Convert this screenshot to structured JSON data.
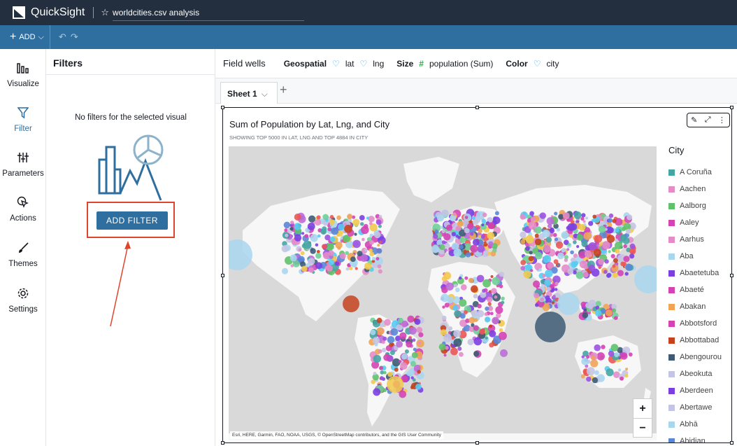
{
  "app": {
    "brand": "QuickSight",
    "analysis_title": "worldcities.csv analysis"
  },
  "toolbar": {
    "add_label": "ADD",
    "undo": "↶",
    "redo": "↷"
  },
  "nav": [
    {
      "label": "Visualize",
      "icon": "bar-chart-icon"
    },
    {
      "label": "Filter",
      "icon": "filter-icon"
    },
    {
      "label": "Parameters",
      "icon": "sliders-icon"
    },
    {
      "label": "Actions",
      "icon": "cursor-click-icon"
    },
    {
      "label": "Themes",
      "icon": "brush-icon"
    },
    {
      "label": "Settings",
      "icon": "gear-icon"
    }
  ],
  "filters": {
    "heading": "Filters",
    "empty_message": "No filters for the selected visual",
    "add_filter_label": "ADD FILTER"
  },
  "fieldwells": {
    "title": "Field wells",
    "geo_label": "Geospatial",
    "geo_1": "lat",
    "geo_2": "lng",
    "size_label": "Size",
    "size_value": "population (Sum)",
    "color_label": "Color",
    "color_value": "city"
  },
  "sheet": {
    "tab_label": "Sheet 1"
  },
  "visual": {
    "title": "Sum of Population by Lat, Lng, and City",
    "subtitle": "SHOWING TOP 5000 IN LAT, LNG AND TOP 4884 IN CITY",
    "attribution": "Esri, HERE, Garmin, FAO, NOAA, USGS, © OpenStreetMap contributors, and the GIS User Community",
    "zoom_in": "+",
    "zoom_out": "−",
    "legend_title": "City",
    "legend": [
      {
        "label": "A Coruña",
        "color": "#45a5a3"
      },
      {
        "label": "Aachen",
        "color": "#e38cc8"
      },
      {
        "label": "Aalborg",
        "color": "#5fc26a"
      },
      {
        "label": "Aaley",
        "color": "#d442b4"
      },
      {
        "label": "Aarhus",
        "color": "#e38cc8"
      },
      {
        "label": "Aba",
        "color": "#a9d6ef"
      },
      {
        "label": "Abaetetuba",
        "color": "#7b3fe0"
      },
      {
        "label": "Abaeté",
        "color": "#d442b4"
      },
      {
        "label": "Abakan",
        "color": "#f0a454"
      },
      {
        "label": "Abbotsford",
        "color": "#d442b4"
      },
      {
        "label": "Abbottabad",
        "color": "#c5421e"
      },
      {
        "label": "Abengourou",
        "color": "#3e5b73"
      },
      {
        "label": "Abeokuta",
        "color": "#c4c4e4"
      },
      {
        "label": "Aberdeen",
        "color": "#7b3fe0"
      },
      {
        "label": "Abertawe",
        "color": "#c4c4e4"
      },
      {
        "label": "Abhā",
        "color": "#a9d6ef"
      },
      {
        "label": "Abidjan",
        "color": "#5a86d6"
      }
    ]
  }
}
